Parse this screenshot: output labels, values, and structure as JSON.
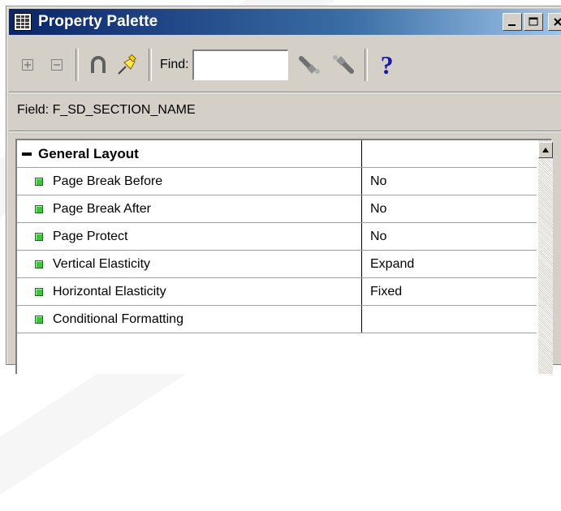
{
  "window": {
    "title": "Property Palette",
    "min_label": "_",
    "max_label": "□",
    "close_label": "✕"
  },
  "toolbar": {
    "find_label": "Find:",
    "find_value": "",
    "help_label": "?"
  },
  "field": {
    "text": "Field: F_SD_SECTION_NAME"
  },
  "grid": {
    "group": {
      "name": "General Layout",
      "value": ""
    },
    "properties": [
      {
        "name": "Page Break Before",
        "value": "No"
      },
      {
        "name": "Page Break After",
        "value": "No"
      },
      {
        "name": "Page Protect",
        "value": "No"
      },
      {
        "name": "Vertical Elasticity",
        "value": "Expand"
      },
      {
        "name": "Horizontal Elasticity",
        "value": "Fixed"
      },
      {
        "name": "Conditional Formatting",
        "value": ""
      }
    ]
  },
  "colors": {
    "titlebar_start": "#0a246a",
    "titlebar_end": "#a6caf0",
    "window_bg": "#d4d0c8",
    "bullet": "#33cc33"
  }
}
